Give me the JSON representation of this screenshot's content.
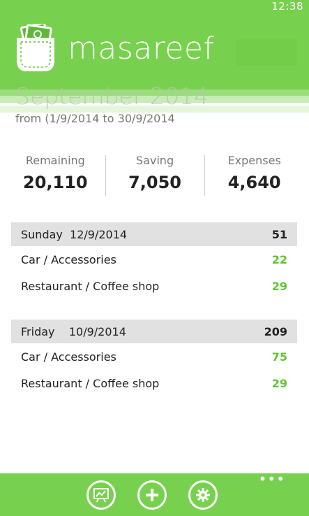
{
  "status": {
    "time": "12:38"
  },
  "header": {
    "app_name": "masareef",
    "logo_icon": "pocket-money-icon"
  },
  "period": {
    "title": "September 2014",
    "range": "from (1/9/2014 to 30/9/2014"
  },
  "summary": {
    "remaining_label": "Remaining",
    "remaining_value": "20,110",
    "saving_label": "Saving",
    "saving_value": "7,050",
    "expenses_label": "Expenses",
    "expenses_value": "4,640"
  },
  "days": [
    {
      "name": "Sunday  12/9/2014",
      "total": "51",
      "entries": [
        {
          "category": "Car / Accessories",
          "amount": "22"
        },
        {
          "category": "Restaurant / Coffee shop",
          "amount": "29"
        }
      ]
    },
    {
      "name": "Friday    10/9/2014",
      "total": "209",
      "entries": [
        {
          "category": "Car / Accessories",
          "amount": "75"
        },
        {
          "category": "Restaurant / Coffee shop",
          "amount": "29"
        }
      ]
    }
  ],
  "appbar": {
    "more_label": "•••",
    "buttons": [
      {
        "icon": "chart-icon"
      },
      {
        "icon": "add-icon"
      },
      {
        "icon": "settings-gear-icon"
      }
    ]
  },
  "colors": {
    "accent": "#78d14e",
    "amount_green": "#5fc531",
    "day_header_bg": "#e1e1e1"
  }
}
